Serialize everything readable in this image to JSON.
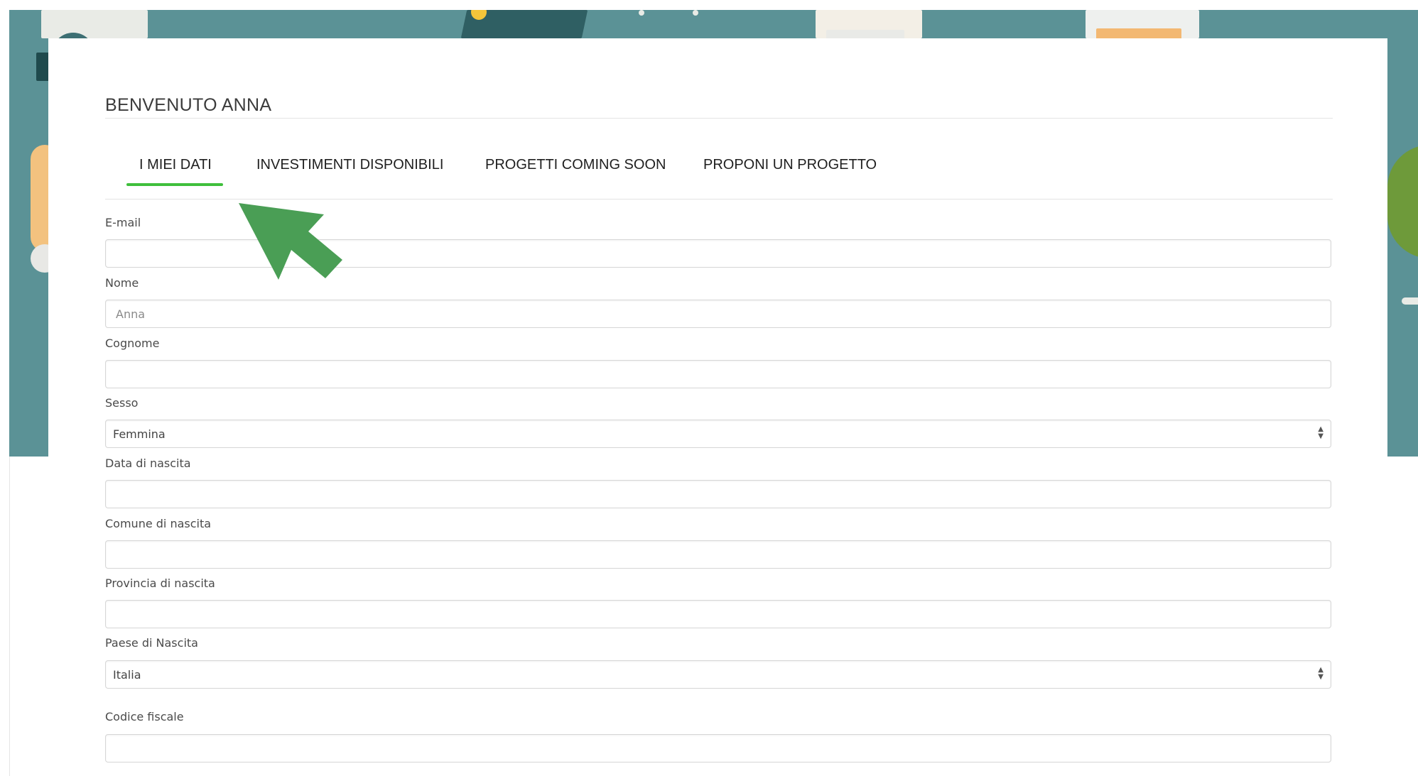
{
  "header": {
    "welcome": "BENVENUTO ANNA"
  },
  "tabs": [
    {
      "label": "I MIEI DATI",
      "active": true
    },
    {
      "label": "INVESTIMENTI DISPONIBILI",
      "active": false
    },
    {
      "label": "PROGETTI COMING SOON",
      "active": false
    },
    {
      "label": "PROPONI UN PROGETTO",
      "active": false
    }
  ],
  "form": {
    "email": {
      "label": "E-mail",
      "value": ""
    },
    "nome": {
      "label": "Nome",
      "placeholder": "Anna"
    },
    "cognome": {
      "label": "Cognome",
      "value": ""
    },
    "sesso": {
      "label": "Sesso",
      "value": "Femmina"
    },
    "data_nascita": {
      "label": "Data di nascita",
      "value": ""
    },
    "comune_nascita": {
      "label": "Comune di nascita",
      "value": ""
    },
    "provincia_nascita": {
      "label": "Provincia di nascita",
      "value": ""
    },
    "paese_nascita": {
      "label": "Paese di Nascita",
      "value": "Italia"
    },
    "codice_fiscale": {
      "label": "Codice fiscale",
      "value": ""
    }
  },
  "colors": {
    "accent": "#3fbf3c",
    "annotation_arrow": "#4a9e55",
    "hero_background": "#5b9296"
  },
  "icons": {
    "select_arrows": "up-down-caret-icon",
    "annotation": "pointer-arrow-icon"
  }
}
